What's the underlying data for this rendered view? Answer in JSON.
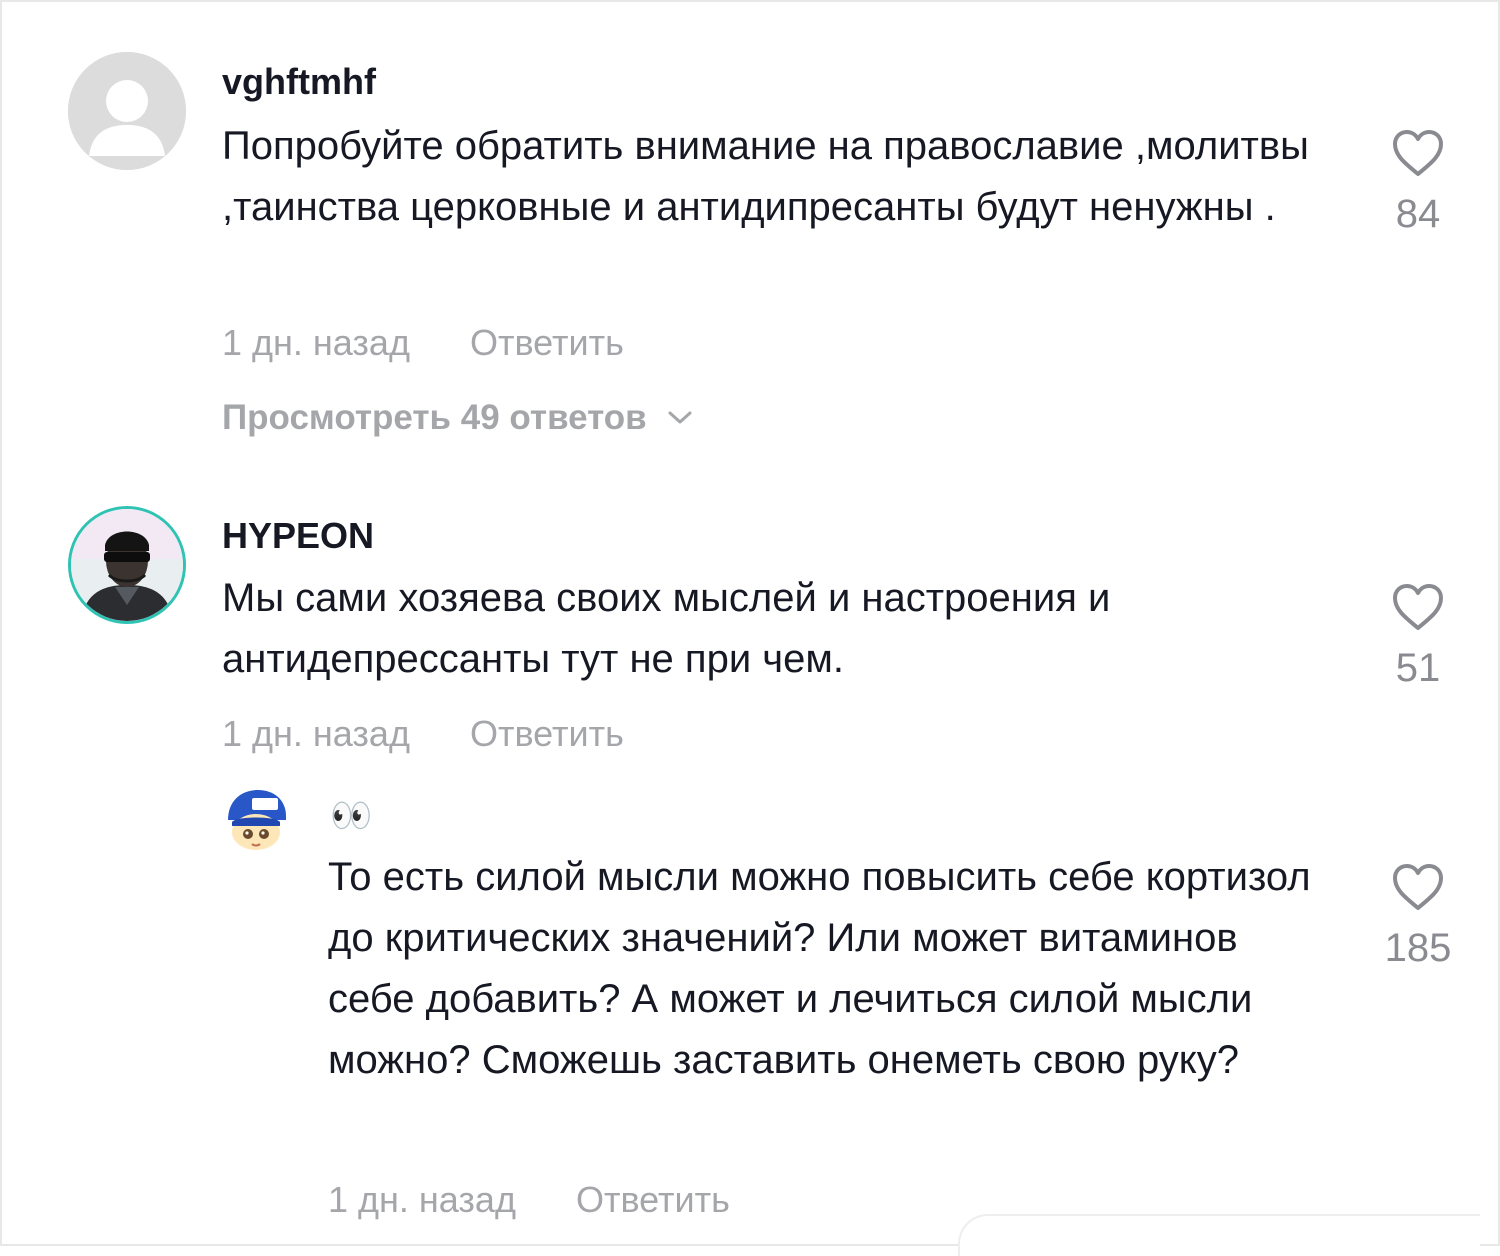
{
  "comments": [
    {
      "username": "vghftmhf",
      "text": "Попробуйте обратить внимание на православие ,молитвы ,таинства церковные и антидипресанты будут ненужны .",
      "time": "1 дн. назад",
      "reply_label": "Ответить",
      "likes": "84",
      "view_replies": "Просмотреть 49 ответов",
      "avatar": "default-avatar-icon"
    },
    {
      "username": "HYPEON",
      "text": "Мы сами хозяева своих мыслей и настроения и антидепрессанты тут не при чем.",
      "time": "1 дн. назад",
      "reply_label": "Ответить",
      "likes": "51",
      "avatar": "profile-photo",
      "replies": [
        {
          "username": "👀",
          "text": "То есть силой мысли можно повысить себе кортизол до критических значений? Или может витаминов себе добавить? А может и лечиться силой мысли можно? Сможешь заставить онеметь свою руку?",
          "time": "1 дн. назад",
          "reply_label": "Ответить",
          "likes": "185",
          "avatar": "cartoon-avatar"
        }
      ]
    }
  ],
  "icons": {
    "like": "heart-outline-icon",
    "expand": "chevron-down-icon"
  },
  "colors": {
    "text": "#161823",
    "muted": "#a4a6aa",
    "like_count": "#8a8b91",
    "avatar_border": "#2fc3b4"
  }
}
